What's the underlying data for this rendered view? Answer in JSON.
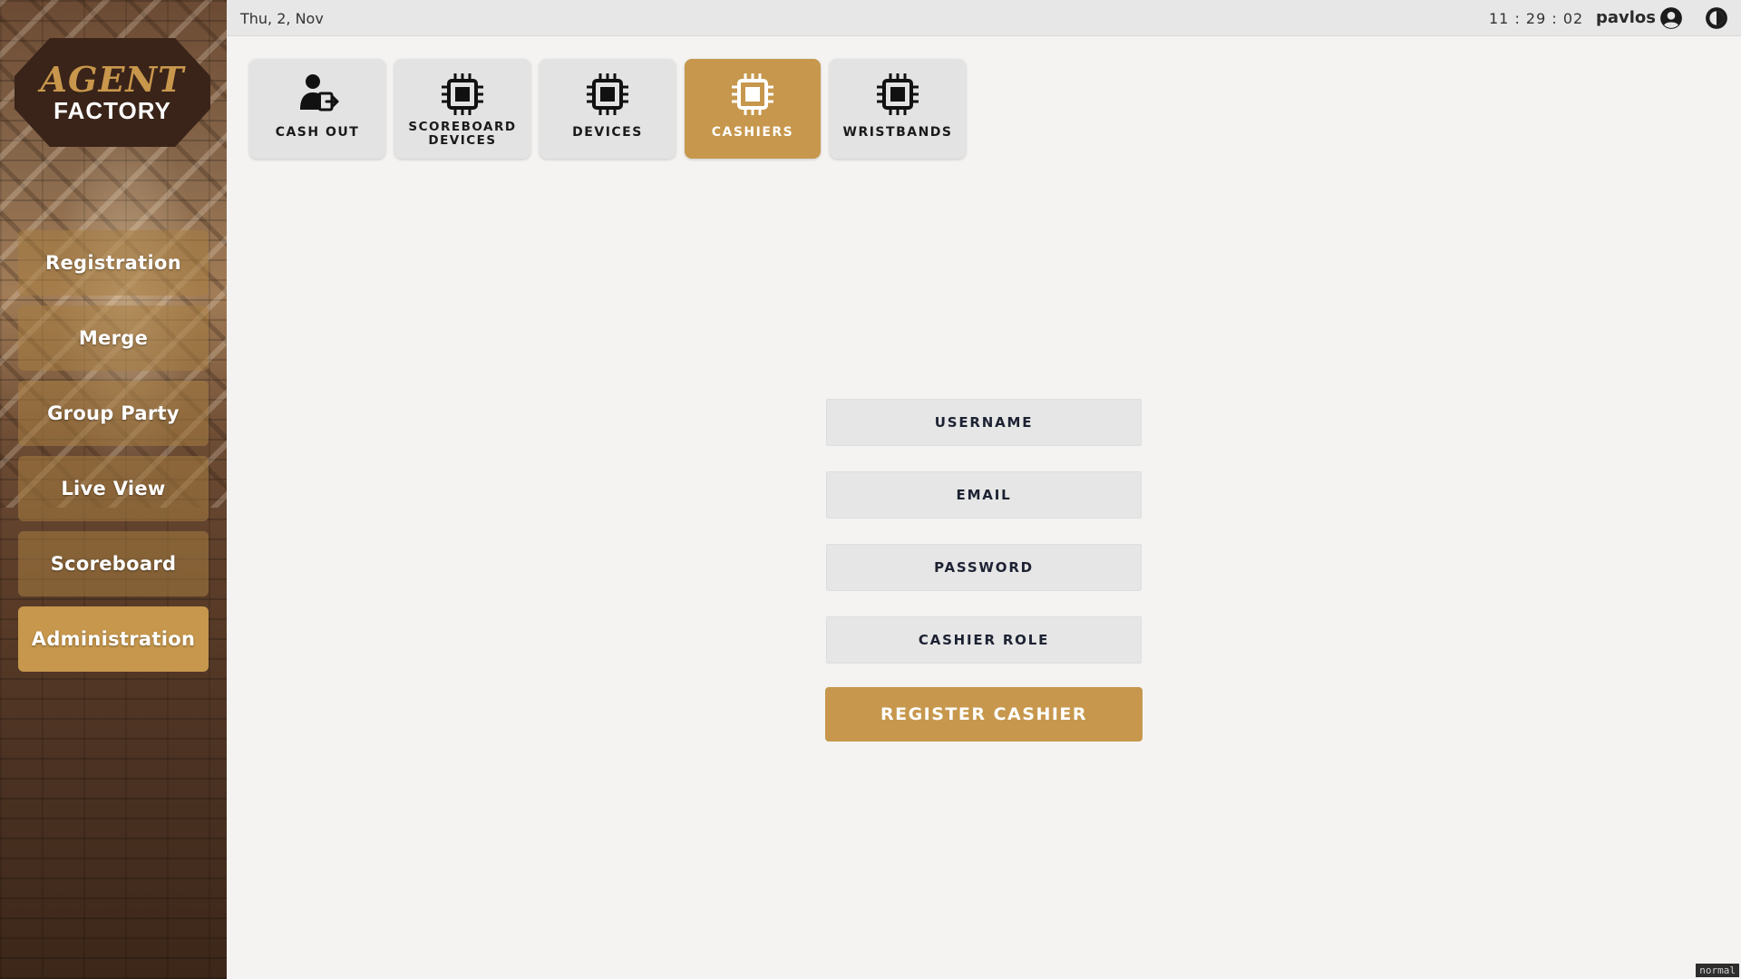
{
  "brand": {
    "line1": "AGENT",
    "line2": "FACTORY"
  },
  "topbar": {
    "date": "Thu, 2, Nov",
    "time": "11 : 29 : 02",
    "username": "pavlos",
    "user_icon": "user-circle-icon",
    "theme_icon": "contrast-icon"
  },
  "sidebar": {
    "items": [
      {
        "label": "Registration",
        "active": false
      },
      {
        "label": "Merge",
        "active": false
      },
      {
        "label": "Group Party",
        "active": false
      },
      {
        "label": "Live View",
        "active": false
      },
      {
        "label": "Scoreboard",
        "active": false
      },
      {
        "label": "Administration",
        "active": true
      }
    ]
  },
  "tiles": [
    {
      "line1": "CASH OUT",
      "line2": "",
      "icon": "user-exit-icon",
      "active": false
    },
    {
      "line1": "SCOREBOARD",
      "line2": "DEVICES",
      "icon": "chip-icon",
      "active": false
    },
    {
      "line1": "DEVICES",
      "line2": "",
      "icon": "chip-icon",
      "active": false
    },
    {
      "line1": "CASHIERS",
      "line2": "",
      "icon": "chip-icon",
      "active": true
    },
    {
      "line1": "WRISTBANDS",
      "line2": "",
      "icon": "chip-icon",
      "active": false
    }
  ],
  "form": {
    "username_placeholder": "USERNAME",
    "email_placeholder": "EMAIL",
    "password_placeholder": "PASSWORD",
    "role_placeholder": "CASHIER ROLE",
    "submit_label": "REGISTER CASHIER"
  },
  "corner_tag": "normal",
  "colors": {
    "accent": "#c6974c",
    "tile_bg": "#e3e3e3",
    "field_bg": "#e6e6e6"
  }
}
